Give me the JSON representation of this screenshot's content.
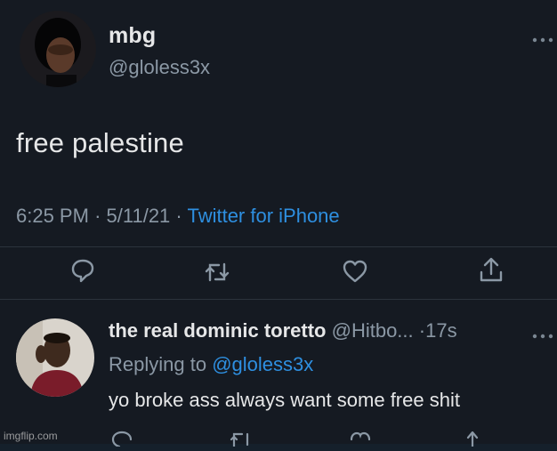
{
  "main_tweet": {
    "author_name": "mbg",
    "author_handle": "@gloless3x",
    "text": "free palestine",
    "time": "6:25 PM",
    "date": "5/11/21",
    "separator": "·",
    "source": "Twitter for iPhone",
    "more_icon": "more-horizontal-icon",
    "actions": [
      {
        "icon": "reply-icon"
      },
      {
        "icon": "retweet-icon"
      },
      {
        "icon": "like-icon"
      },
      {
        "icon": "share-icon"
      }
    ]
  },
  "reply_tweet": {
    "author_name": "the real dominic toretto",
    "author_handle": "@Hitbo...",
    "separator": "·",
    "time_ago": "17s",
    "replying_prefix": "Replying to",
    "replying_to": "@gloless3x",
    "text": "yo broke ass always want some free shit",
    "more_icon": "more-horizontal-icon"
  },
  "watermark": "imgflip.com",
  "colors": {
    "background": "#151a22",
    "primary_text": "#e6e7e8",
    "secondary_text": "#8b98a5",
    "link": "#2e8fe0",
    "divider": "#2c333d"
  }
}
